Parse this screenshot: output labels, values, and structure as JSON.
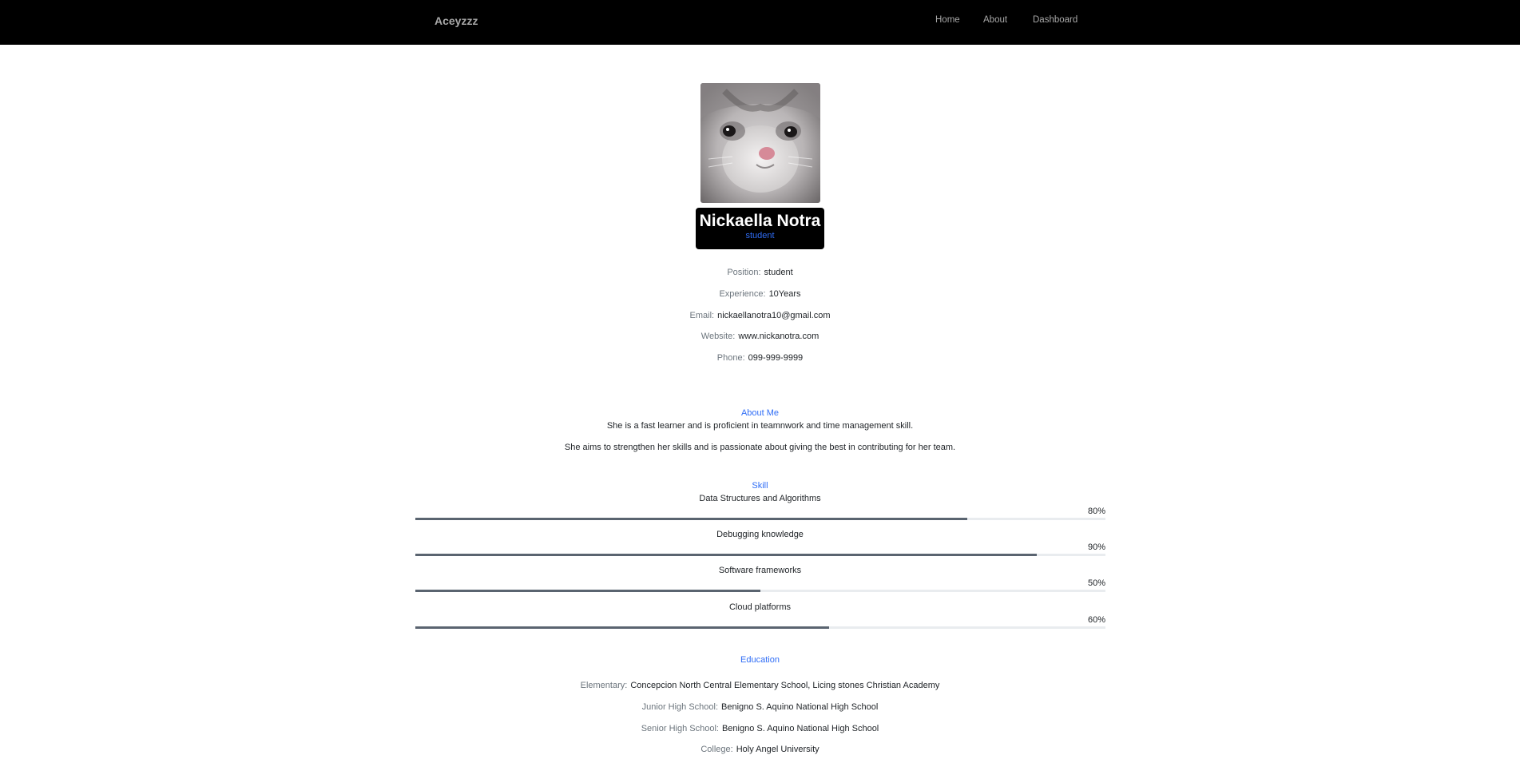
{
  "nav": {
    "brand": "Aceyzzz",
    "links": [
      "Home",
      "About",
      "Dashboard"
    ]
  },
  "profile": {
    "avatar": "cat-photo",
    "name": "Nickaella Notra",
    "role": "student"
  },
  "details": [
    {
      "label": "Position:",
      "value": "student"
    },
    {
      "label": "Experience:",
      "value": "10Years"
    },
    {
      "label": "Email:",
      "value": "nickaellanotra10@gmail.com"
    },
    {
      "label": "Website:",
      "value": "www.nickanotra.com"
    },
    {
      "label": "Phone:",
      "value": "099-999-9999"
    }
  ],
  "about": {
    "title": "About Me",
    "paragraphs": [
      "She is a fast learner and is proficient in teamnwork and time management skill.",
      "She aims to strengthen her skills and is passionate about giving the best in contributing for her team."
    ]
  },
  "skills": {
    "title": "Skill",
    "items": [
      {
        "name": "Data Structures and Algorithms",
        "percent_label": "80%",
        "level": 80
      },
      {
        "name": "Debugging knowledge",
        "percent_label": "90%",
        "level": 90
      },
      {
        "name": "Software frameworks",
        "percent_label": "50%",
        "level": 50
      },
      {
        "name": "Cloud platforms",
        "percent_label": "60%",
        "level": 60
      }
    ]
  },
  "education": {
    "title": "Education",
    "items": [
      {
        "label": "Elementary:",
        "value": "Concepcion North Central Elementary School, Licing stones Christian Academy"
      },
      {
        "label": "Junior High School:",
        "value": "Benigno S. Aquino National High School"
      },
      {
        "label": "Senior High School:",
        "value": "Benigno S. Aquino National High School"
      },
      {
        "label": "College:",
        "value": "Holy Angel University"
      }
    ]
  },
  "colors": {
    "navbar": "#000000",
    "accent": "#2f6df6",
    "skill_fill": "#5a6470",
    "skill_track": "#e9ecef"
  }
}
